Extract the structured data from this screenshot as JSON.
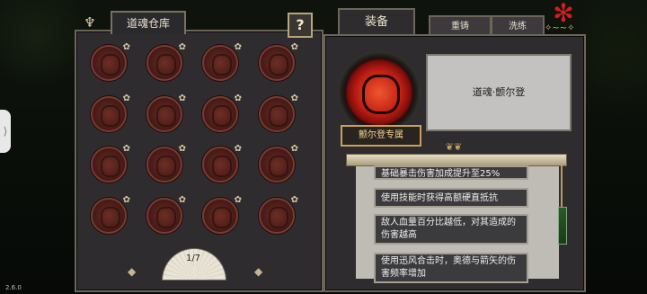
{
  "colors": {
    "accent_red": "#c01f14",
    "gold": "#c8a25c",
    "panel": "#2e2c2f"
  },
  "left_panel": {
    "title": "道魂仓库",
    "help_label": "?",
    "page_indicator": "1/7",
    "prev_icon": "◆",
    "next_icon": "◆",
    "slots_icon": "red-soul-medallion",
    "slot_count": 16
  },
  "right_panel": {
    "tabs": [
      {
        "label": "装备"
      },
      {
        "label": "重铸"
      },
      {
        "label": "洗练"
      }
    ],
    "soul_name": "道魂·颤尔登",
    "exclusive_label": "颤尔登专属",
    "effects": [
      "基础暴击伤害加成提升至25%",
      "使用技能时获得高额硬直抵抗",
      "敌人血量百分比越低，对其造成的伤害越高",
      "使用迅风合击时，奥德与箭矢的伤害频率增加"
    ]
  },
  "system": {
    "version": "2.6.0"
  }
}
